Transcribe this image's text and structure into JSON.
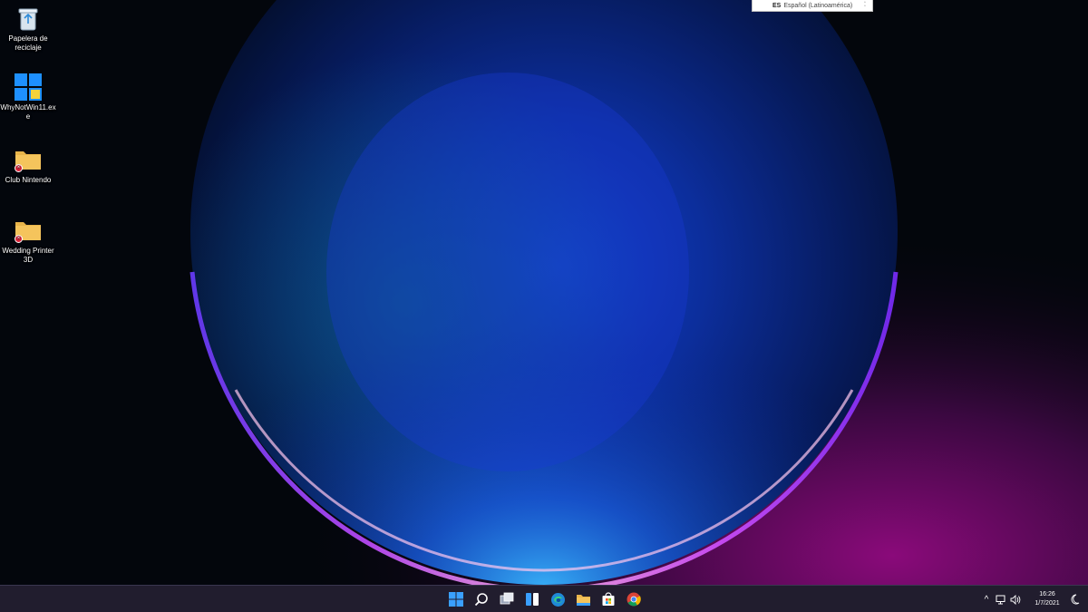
{
  "desktop": {
    "icons": [
      {
        "label": "Papelera de reciclaje",
        "icon": "recycle-bin-icon"
      },
      {
        "label": "WhyNotWin11.exe",
        "icon": "windows-logo-icon"
      },
      {
        "label": "Club Nintendo",
        "icon": "folder-icon",
        "badge": "×"
      },
      {
        "label": "Wedding Printer 3D",
        "icon": "folder-icon",
        "badge": "×"
      }
    ]
  },
  "language_bar": {
    "code": "ES",
    "name": "Español (Latinoamérica)"
  },
  "taskbar": {
    "apps": [
      "start-icon",
      "search-icon",
      "task-view-icon",
      "widgets-icon",
      "edge-icon",
      "file-explorer-icon",
      "store-icon",
      "chrome-icon"
    ],
    "tray": {
      "chevron": "^",
      "time": "16:26",
      "date": "1/7/2021"
    }
  },
  "colors": {
    "taskbar_bg": "#221e30",
    "accent": "#2f8fff",
    "folder": "#f5c45c"
  }
}
